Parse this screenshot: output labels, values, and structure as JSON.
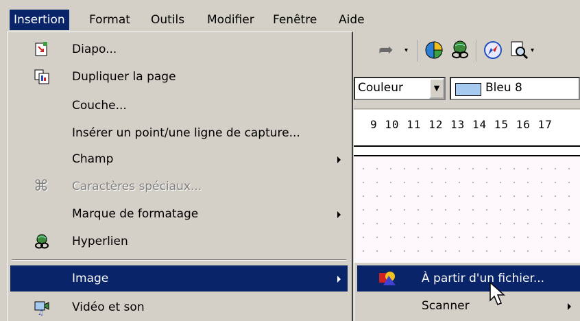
{
  "menubar": {
    "items": [
      "Insertion",
      "Format",
      "Outils",
      "Modifier",
      "Fenêtre",
      "Aide"
    ]
  },
  "toolbar": {
    "color_mode": "Couleur",
    "color_value": "Bleu 8",
    "ruler_numbers": "9 10 11 12 13 14 15 16 17"
  },
  "menu": {
    "items": [
      {
        "label": "Diapo...",
        "icon": "slide-icon"
      },
      {
        "label": "Dupliquer la page",
        "icon": "duplicate-page-icon"
      },
      {
        "label": "Couche..."
      },
      {
        "label": "Insérer un point/une ligne de capture..."
      },
      {
        "label": "Champ"
      },
      {
        "label": "Caractères spéciaux...",
        "icon": "command-symbol-icon"
      },
      {
        "label": "Marque de formatage"
      },
      {
        "label": "Hyperlien",
        "icon": "hyperlink-globe-icon"
      },
      {
        "label": "Image"
      },
      {
        "label": "Vidéo et son",
        "icon": "video-sound-icon"
      }
    ]
  },
  "submenu": {
    "items": [
      {
        "label": "À partir d'un fichier...",
        "icon": "image-from-file-icon"
      },
      {
        "label": "Scanner"
      }
    ]
  },
  "colors": {
    "highlight": "#0a246a",
    "menu_bg": "#d4d0c8",
    "disabled": "#808080",
    "swatch_blue8": "#a6caf0"
  }
}
